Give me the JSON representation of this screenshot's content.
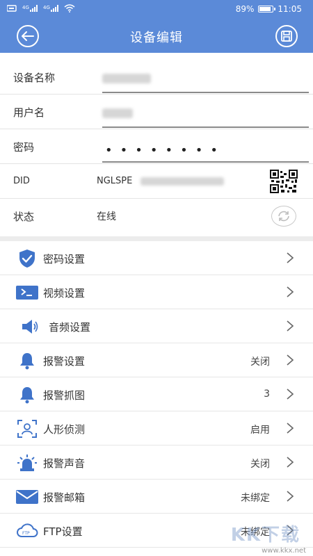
{
  "statusbar": {
    "signals": "ᵍᵃᵢl ᵍᵃᵢl",
    "battery_text": "89%",
    "battery_level": 0.89,
    "time": "11:05"
  },
  "nav": {
    "title": "设备编辑",
    "back_icon": "back-arrow-icon",
    "save_icon": "save-icon"
  },
  "info": {
    "name_label": "设备名称",
    "user_label": "用户名",
    "password_label": "密码",
    "password_value": "••••••••",
    "did_label": "DID",
    "did_value": "NGLSPE",
    "status_label": "状态",
    "status_value": "在线"
  },
  "menu": [
    {
      "label": "密码设置",
      "value": "",
      "icon": "shield-check-icon"
    },
    {
      "label": "视频设置",
      "value": "",
      "icon": "video-terminal-icon"
    },
    {
      "label": "音频设置",
      "value": "",
      "icon": "speaker-icon"
    },
    {
      "label": "报警设置",
      "value": "关闭",
      "icon": "bell-icon"
    },
    {
      "label": "报警抓图",
      "value": "3",
      "icon": "bell-capture-icon"
    },
    {
      "label": "人形侦测",
      "value": "启用",
      "icon": "person-detect-icon"
    },
    {
      "label": "报警声音",
      "value": "关闭",
      "icon": "alarm-siren-icon"
    },
    {
      "label": "报警邮箱",
      "value": "未绑定",
      "icon": "mail-icon"
    },
    {
      "label": "FTP设置",
      "value": "未绑定",
      "icon": "ftp-cloud-icon"
    }
  ],
  "watermark": {
    "logo": "KK下载",
    "url": "www.kkx.net"
  },
  "colors": {
    "accent": "#5b8ad8"
  }
}
